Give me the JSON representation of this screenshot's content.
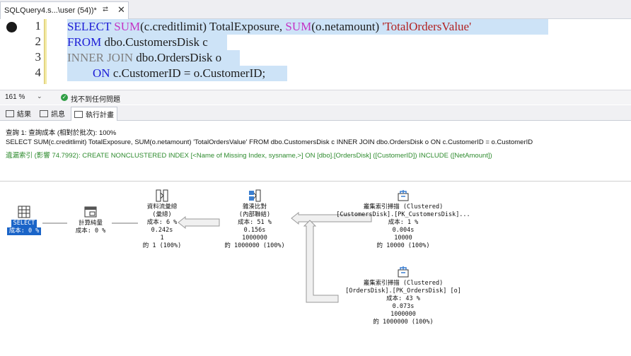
{
  "tab": {
    "title": "SQLQuery4.s...\\user (54))*",
    "pin_icon": "pin-icon",
    "close_icon": "close-icon"
  },
  "editor": {
    "lines": [
      {
        "number": "1"
      },
      {
        "number": "2"
      },
      {
        "number": "3"
      },
      {
        "number": "4"
      }
    ],
    "line1": {
      "kw_select": "SELECT",
      "fn_sum1": "SUM",
      "t1": "(c.creditlimit) TotalExposure, ",
      "fn_sum2": "SUM",
      "t2": "(o.netamount) ",
      "str": "'TotalOrdersValue'"
    },
    "line2": {
      "kw_from": "FROM",
      "t": " dbo.CustomersDisk c"
    },
    "line3": {
      "kw_inner": "INNER JOIN",
      "t": " dbo.OrdersDisk o"
    },
    "line4": {
      "kw_on": "ON",
      "t": " c.CustomerID = o.CustomerID;"
    }
  },
  "status": {
    "zoom": "161 %",
    "issues": "找不到任何問題"
  },
  "result_tabs": [
    {
      "label": "結果"
    },
    {
      "label": "訊息"
    },
    {
      "label": "執行計畫"
    }
  ],
  "messages": {
    "line1": "查詢 1: 查詢成本 (相對於批次): 100%",
    "line2": "SELECT SUM(c.creditlimit) TotalExposure, SUM(o.netamount) 'TotalOrdersValue' FROM dbo.CustomersDisk c INNER JOIN dbo.OrdersDisk o ON c.CustomerID = o.CustomerID",
    "line3": "遺漏索引 (影響 74.7992): CREATE NONCLUSTERED INDEX [<Name of Missing Index, sysname,>] ON [dbo].[OrdersDisk] ([CustomerID]) INCLUDE ([NetAmount])"
  },
  "plan": {
    "select": {
      "label": "SELECT",
      "cost": "成本: 0 %"
    },
    "compute": {
      "label": "計算純量",
      "cost": "成本: 0 %"
    },
    "stream": {
      "label": "資料流彙總",
      "sub": "(彙總)",
      "cost": "成本: 6 %",
      "time": "0.242s",
      "rows": "1",
      "of": "的 1 (100%)"
    },
    "hash": {
      "label": "雜湊比對",
      "sub": "(內部聯結)",
      "cost": "成本: 51 %",
      "time": "0.156s",
      "rows": "1000000",
      "of": "的 1000000 (100%)"
    },
    "scan1": {
      "label": "叢集索引掃描 (Clustered)",
      "object": "[CustomersDisk].[PK_CustomersDisk]...",
      "cost": "成本: 1 %",
      "time": "0.004s",
      "rows": "10000",
      "of": "的 10000 (100%)"
    },
    "scan2": {
      "label": "叢集索引掃描 (Clustered)",
      "object": "[OrdersDisk].[PK_OrdersDisk] [o]",
      "cost": "成本: 43 %",
      "time": "0.073s",
      "rows": "1000000",
      "of": "的 1000000 (100%)"
    }
  }
}
